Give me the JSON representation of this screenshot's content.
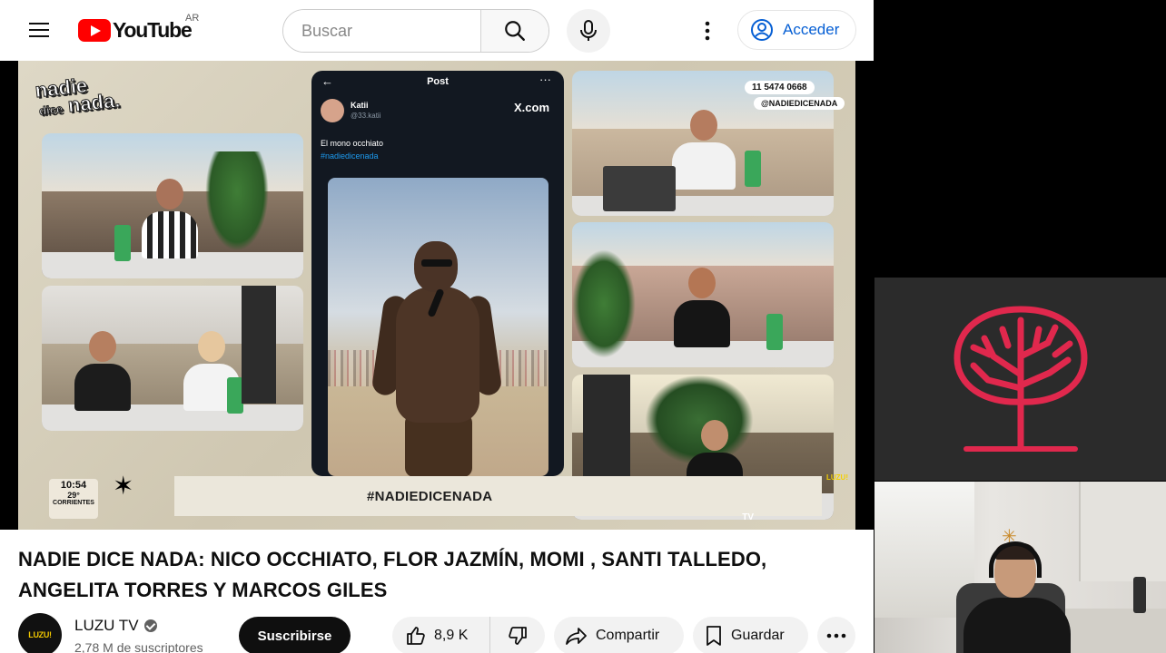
{
  "header": {
    "brand": "YouTube",
    "country_code": "AR",
    "search_placeholder": "Buscar",
    "signin_label": "Acceder"
  },
  "video_overlay": {
    "show_logo_line1": "nadie",
    "show_logo_line2_small": "dice",
    "show_logo_line2": "nada.",
    "post_header": "Post",
    "post_user": "Katii",
    "post_handle": "@33.katii",
    "post_site": "X.com",
    "post_text": "El mono occhiato",
    "post_tag": "#nadiedicenada",
    "phone_number": "11 5474 0668",
    "social_handle": "@NADIEDICENADA",
    "hashtag": "#NADIEDICENADA",
    "clock_time": "10:54",
    "temperature": "29°",
    "city": "CORRIENTES",
    "tv_mark": "TV",
    "side_logo": "LUZU!"
  },
  "video": {
    "title": "NADIE DICE NADA: NICO OCCHIATO, FLOR JAZMÍN, MOMI , SANTI TALLEDO, ANGELITA TORRES Y MARCOS GILES",
    "channel_name": "LUZU TV",
    "channel_avatar_text": "LUZU!",
    "subscribers": "2,78 M de suscriptores",
    "subscribe_label": "Suscribirse",
    "likes": "8,9 K",
    "share_label": "Compartir",
    "save_label": "Guardar"
  },
  "colors": {
    "brand_red": "#ff0000",
    "link_blue": "#065fd4",
    "brain_logo": "#e0284d"
  },
  "icons": [
    "menu-icon",
    "youtube-logo-icon",
    "search-icon",
    "microphone-icon",
    "more-vert-icon",
    "account-icon",
    "like-icon",
    "dislike-icon",
    "share-icon",
    "save-icon",
    "more-horiz-icon",
    "verified-icon",
    "brain-tree-icon"
  ]
}
